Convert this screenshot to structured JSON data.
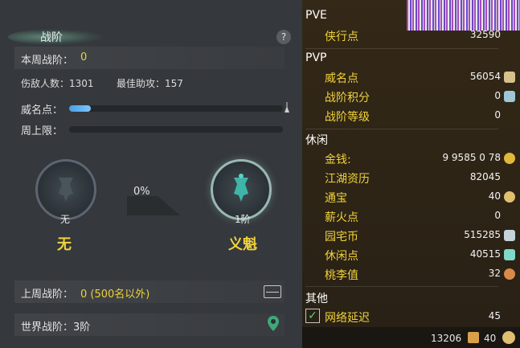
{
  "left": {
    "title": "战阶",
    "help": "?",
    "weekly_rank_label": "本周战阶：",
    "weekly_rank_value": "0",
    "kills_label": "伤敌人数：1301",
    "assists_label": "最佳助攻：157",
    "prestige_label": "威名点：",
    "weekly_cap_label": "周上限：",
    "prestige_progress": 0.1,
    "weekly_cap_progress": 0,
    "emblem_left_level": "无",
    "emblem_left_name": "无",
    "progress_pct": "0%",
    "emblem_right_level": "1阶",
    "emblem_right_name": "义魁",
    "last_week_label": "上周战阶：",
    "last_week_value": "0 (500名以外)",
    "world_label": "世界战阶：3阶"
  },
  "right": {
    "pve": "PVE",
    "pvp": "PVP",
    "leisure": "休闲",
    "other": "其他",
    "rows": [
      {
        "label": "侠行点",
        "value": "32590"
      },
      {
        "label": "威名点",
        "value": "56054"
      },
      {
        "label": "战阶积分",
        "value": "0"
      },
      {
        "label": "战阶等级",
        "value": "0"
      },
      {
        "label": "金钱:",
        "value": "9  9585  0  78"
      },
      {
        "label": "江湖资历",
        "value": "82045"
      },
      {
        "label": "通宝",
        "value": "40"
      },
      {
        "label": "薪火点",
        "value": "0"
      },
      {
        "label": "园宅币",
        "value": "515285"
      },
      {
        "label": "休闲点",
        "value": "40515"
      },
      {
        "label": "桃李值",
        "value": "32"
      },
      {
        "label": "网络延迟",
        "value": "45"
      }
    ],
    "footer_left": "13206",
    "footer_right": "40"
  }
}
